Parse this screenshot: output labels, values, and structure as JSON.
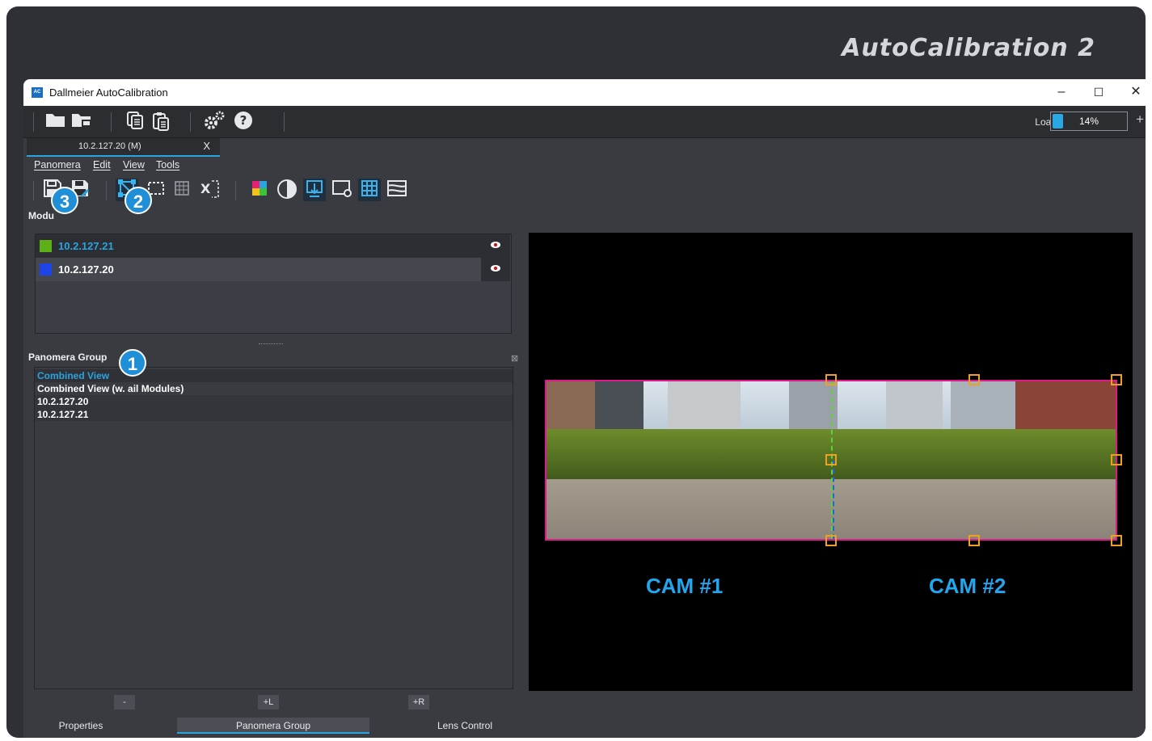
{
  "brand": "AutoCalibration 2",
  "window": {
    "title": "Dallmeier AutoCalibration",
    "app_icon": "AC",
    "controls": {
      "minimize": "–",
      "maximize": "☐",
      "close": "✕"
    }
  },
  "toolbar": {
    "icons": [
      "open-folder-icon",
      "open-config-icon",
      "copy-icon",
      "paste-icon",
      "settings-icon",
      "help-icon"
    ],
    "load_label": "Load",
    "load_value": "14%",
    "load_fraction": 0.14,
    "plus": "+"
  },
  "doc_tab": {
    "label": "10.2.127.20 (M)",
    "close": "X"
  },
  "menu": [
    "Panomera",
    "Edit",
    "View",
    "Tools"
  ],
  "toolbar2": {
    "icons": [
      "save-icon",
      "save-as-icon",
      "select-handles-icon",
      "crop-icon",
      "grid-small-icon",
      "distort-icon",
      "color-icon",
      "exposure-icon",
      "calibrate-icon",
      "preview-icon",
      "grid-icon",
      "blend-icon"
    ]
  },
  "badges": {
    "one": "1",
    "two": "2",
    "three": "3"
  },
  "modules": {
    "title": "Modu",
    "items": [
      {
        "label": "10.2.127.21",
        "color": "#5eb019",
        "selected": true
      },
      {
        "label": "10.2.127.20",
        "color": "#1e44e8",
        "selected": false
      }
    ],
    "eye": "👁"
  },
  "group": {
    "title": "Panomera Group",
    "close": "⊠",
    "items": [
      "Combined View",
      "Combined View (w.      ail Modules)",
      "10.2.127.20",
      "10.2.127.21"
    ]
  },
  "viewport": {
    "cam1": "CAM #1",
    "cam2": "CAM #2",
    "border_color": "#e01a8e",
    "handle_color": "#f0a020"
  },
  "bottom": {
    "buttons": [
      "-",
      "+L",
      "+R"
    ],
    "tabs": [
      "Properties",
      "Panomera Group",
      "Lens Control"
    ],
    "active_tab": "Panomera Group"
  }
}
